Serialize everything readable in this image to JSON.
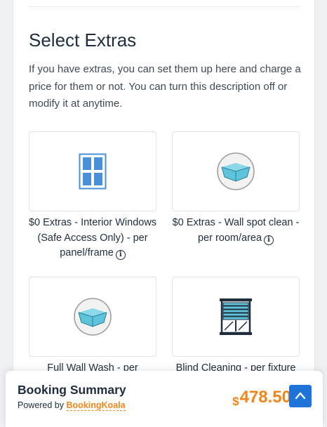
{
  "section": {
    "title": "Select Extras",
    "description": "If you have extras, you can set them up here and charge a price for them or not. You can turn this description off or modify it at anytime."
  },
  "extras": [
    {
      "label": "$0 Extras - Interior Windows (Safe Access Only) - per panel/frame",
      "icon": "window-icon",
      "has_info": true
    },
    {
      "label": "$0 Extras - Wall spot clean - per room/area",
      "icon": "room-walls-icon",
      "has_info": true
    },
    {
      "label": "Full Wall Wash - per",
      "icon": "room-walls-icon",
      "has_info": false
    },
    {
      "label": "Blind Cleaning - per fixture",
      "icon": "window-blinds-icon",
      "has_info": false
    }
  ],
  "summary": {
    "title": "Booking Summary",
    "powered_by_prefix": "Powered by",
    "powered_by_brand": "BookingKoala",
    "currency": "$",
    "amount": "478.50"
  },
  "colors": {
    "accent_orange": "#f0861b",
    "scroll_button_blue": "#1e73d8",
    "icon_blue": "#4a90d9",
    "icon_cyan": "#5ec4dc"
  }
}
